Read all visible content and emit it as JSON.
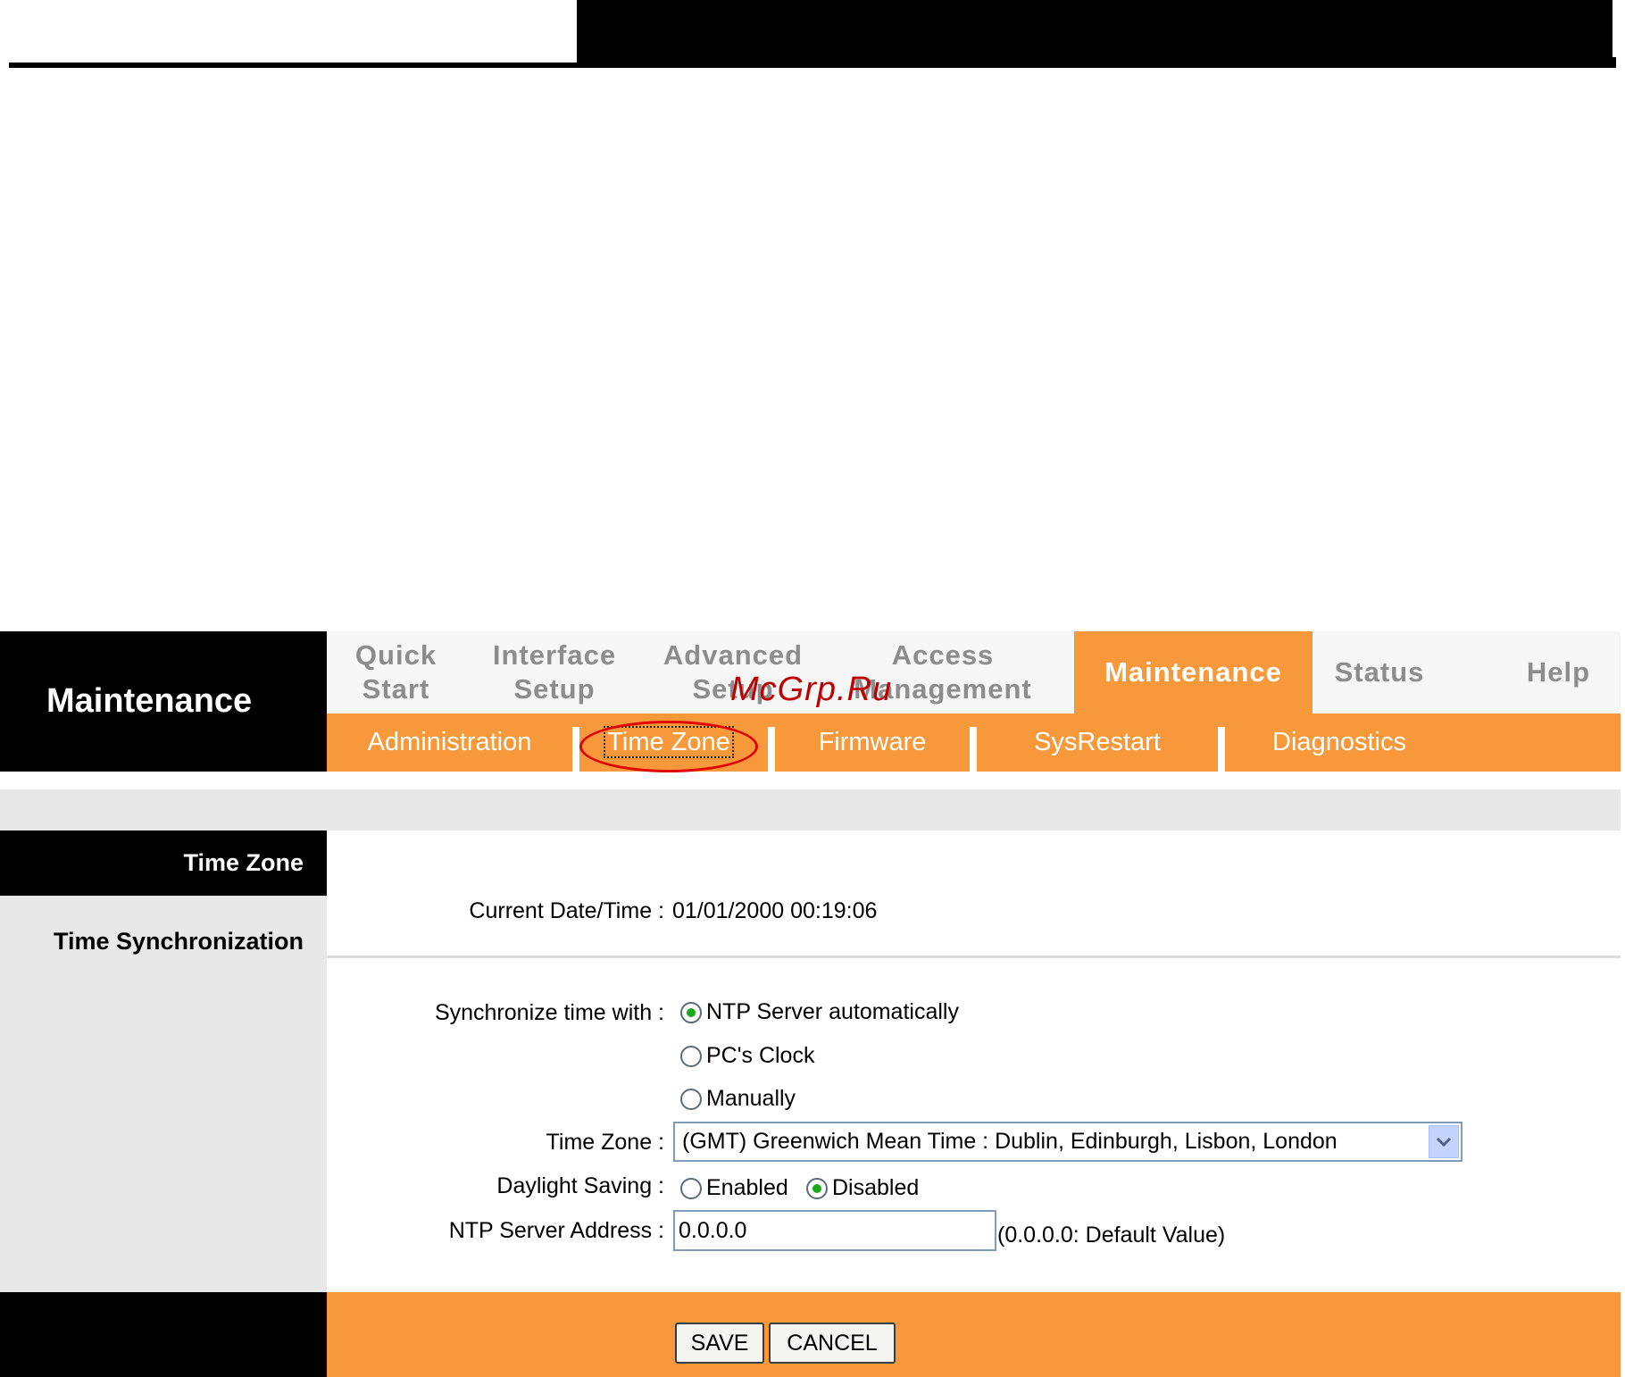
{
  "colors": {
    "accent": "#f7993a",
    "sidebar": "#000000",
    "panel_gray": "#e8e8e8",
    "highlight": "#e00000"
  },
  "sidebar": {
    "title": "Maintenance"
  },
  "main_tabs": [
    {
      "line1": "Quick",
      "line2": "Start"
    },
    {
      "line1": "Interface",
      "line2": "Setup"
    },
    {
      "line1": "Advanced",
      "line2": "Setup"
    },
    {
      "line1": "Access",
      "line2": "Management"
    },
    {
      "line1": "Maintenance",
      "line2": "",
      "active": true
    },
    {
      "line1": "Status",
      "line2": ""
    },
    {
      "line1": "Help",
      "line2": ""
    }
  ],
  "sub_tabs": [
    {
      "label": "Administration"
    },
    {
      "label": "Time Zone",
      "active": true
    },
    {
      "label": "Firmware"
    },
    {
      "label": "SysRestart"
    },
    {
      "label": "Diagnostics"
    }
  ],
  "watermark": "McGrp.Ru",
  "section": {
    "title": "Time Zone",
    "sync_title": "Time Synchronization"
  },
  "fields": {
    "current_datetime_label": "Current Date/Time :",
    "current_datetime_value": "01/01/2000 00:19:06",
    "sync_label": "Synchronize time with :",
    "sync_options": [
      "NTP Server automatically",
      "PC's Clock",
      "Manually"
    ],
    "sync_selected": "NTP Server automatically",
    "timezone_label": "Time Zone :",
    "timezone_value": "(GMT) Greenwich Mean Time : Dublin, Edinburgh, Lisbon, London",
    "daylight_label": "Daylight Saving :",
    "daylight_options": [
      "Enabled",
      "Disabled"
    ],
    "daylight_selected": "Disabled",
    "ntp_label": "NTP Server Address :",
    "ntp_value": "0.0.0.0",
    "ntp_hint": "(0.0.0.0: Default Value)"
  },
  "buttons": {
    "save": "SAVE",
    "cancel": "CANCEL"
  },
  "icons": {
    "dropdown": "chevron-down-icon",
    "radio_checked": "radio-checked-icon",
    "radio_unchecked": "radio-unchecked-icon"
  }
}
